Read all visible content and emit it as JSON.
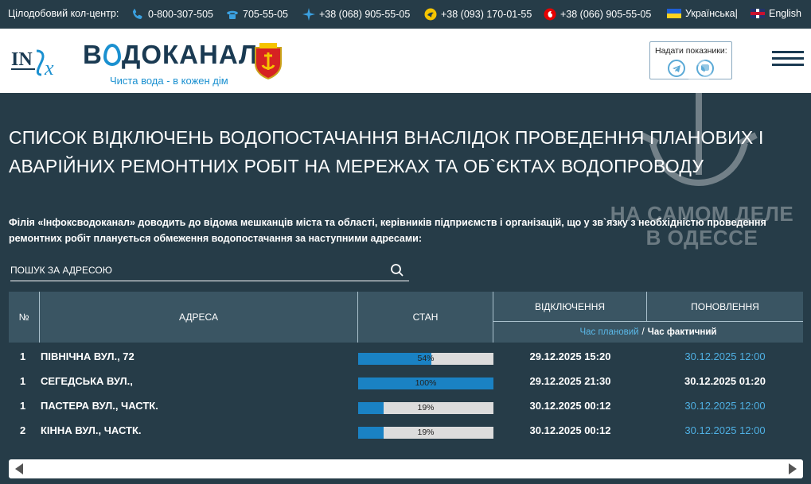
{
  "topbar": {
    "call_center_label": "Цілодобовий кол-центр:",
    "phones": [
      {
        "icon": "phone-icon",
        "number": "0-800-307-505"
      },
      {
        "icon": "landline-phone-icon",
        "number": "705-55-05"
      },
      {
        "icon": "kyivstar-icon",
        "number": "+38 (068) 905-55-05"
      },
      {
        "icon": "lifecell-icon",
        "number": "+38 (093) 170-01-55"
      },
      {
        "icon": "vodafone-icon",
        "number": "+38 (066) 905-55-05"
      }
    ],
    "lang_ua": "Українська",
    "lang_sep": "|",
    "lang_en": "English"
  },
  "header": {
    "brand": "ВОДОКАНАЛ",
    "brand_prefix": "В",
    "brand_suffix": "ДОКАНАЛ",
    "slogan": "Чиста вода - в кожен дім",
    "logo_inf": "INFOX",
    "readings_label": "Надати показники:"
  },
  "main": {
    "title": "СПИСОК ВІДКЛЮЧЕНЬ ВОДОПОСТАЧАННЯ ВНАСЛІДОК ПРОВЕДЕННЯ ПЛАНОВИХ І АВАРІЙНИХ РЕМОНТНИХ РОБІТ НА МЕРЕЖАХ ТА ОБ`ЄКТАХ ВОДОПРОВОДУ",
    "intro": "Філія «Інфоксводоканал» доводить до відома мешканців міста та області, керівників підприємств і організацій, що у зв`язку з необхідністю проведення ремонтних робіт планується обмеження водопостачання за наступними адресами:",
    "search_placeholder": "ПОШУК ЗА АДРЕСОЮ"
  },
  "table": {
    "headers": {
      "num": "№",
      "address": "АДРЕСА",
      "status": "СТАН",
      "off": "ВІДКЛЮЧЕННЯ",
      "update": "ПОНОВЛЕННЯ",
      "time_planned": "Час плановий",
      "time_sep": "/",
      "time_actual": "Час фактичний"
    },
    "rows": [
      {
        "num": "1",
        "address": "ПІВНІЧНА ВУЛ., 72",
        "progress": 54,
        "progress_label": "54%",
        "off": "29.12.2025 15:20",
        "update": "30.12.2025 12:00",
        "update_kind": "planned"
      },
      {
        "num": "1",
        "address": "СЕГЕДСЬКА ВУЛ.,",
        "progress": 100,
        "progress_label": "100%",
        "off": "29.12.2025 21:30",
        "update": "30.12.2025 01:20",
        "update_kind": "actual"
      },
      {
        "num": "1",
        "address": "ПАСТЕРА ВУЛ., ЧАСТК.",
        "progress": 19,
        "progress_label": "19%",
        "off": "30.12.2025 00:12",
        "update": "30.12.2025 12:00",
        "update_kind": "planned"
      },
      {
        "num": "2",
        "address": "КІННА ВУЛ., ЧАСТК.",
        "progress": 19,
        "progress_label": "19%",
        "off": "30.12.2025 00:12",
        "update": "30.12.2025 12:00",
        "update_kind": "planned"
      }
    ]
  },
  "watermark": {
    "line1": "НА САМОМ ДЕЛЕ",
    "line2": "В ОДЕССЕ"
  },
  "colors": {
    "background": "#263c48",
    "table_header": "#3a5563",
    "progress_fill": "#1a82c4",
    "planned_time": "#4fb0e3",
    "brand_dark": "#1a3a52"
  }
}
